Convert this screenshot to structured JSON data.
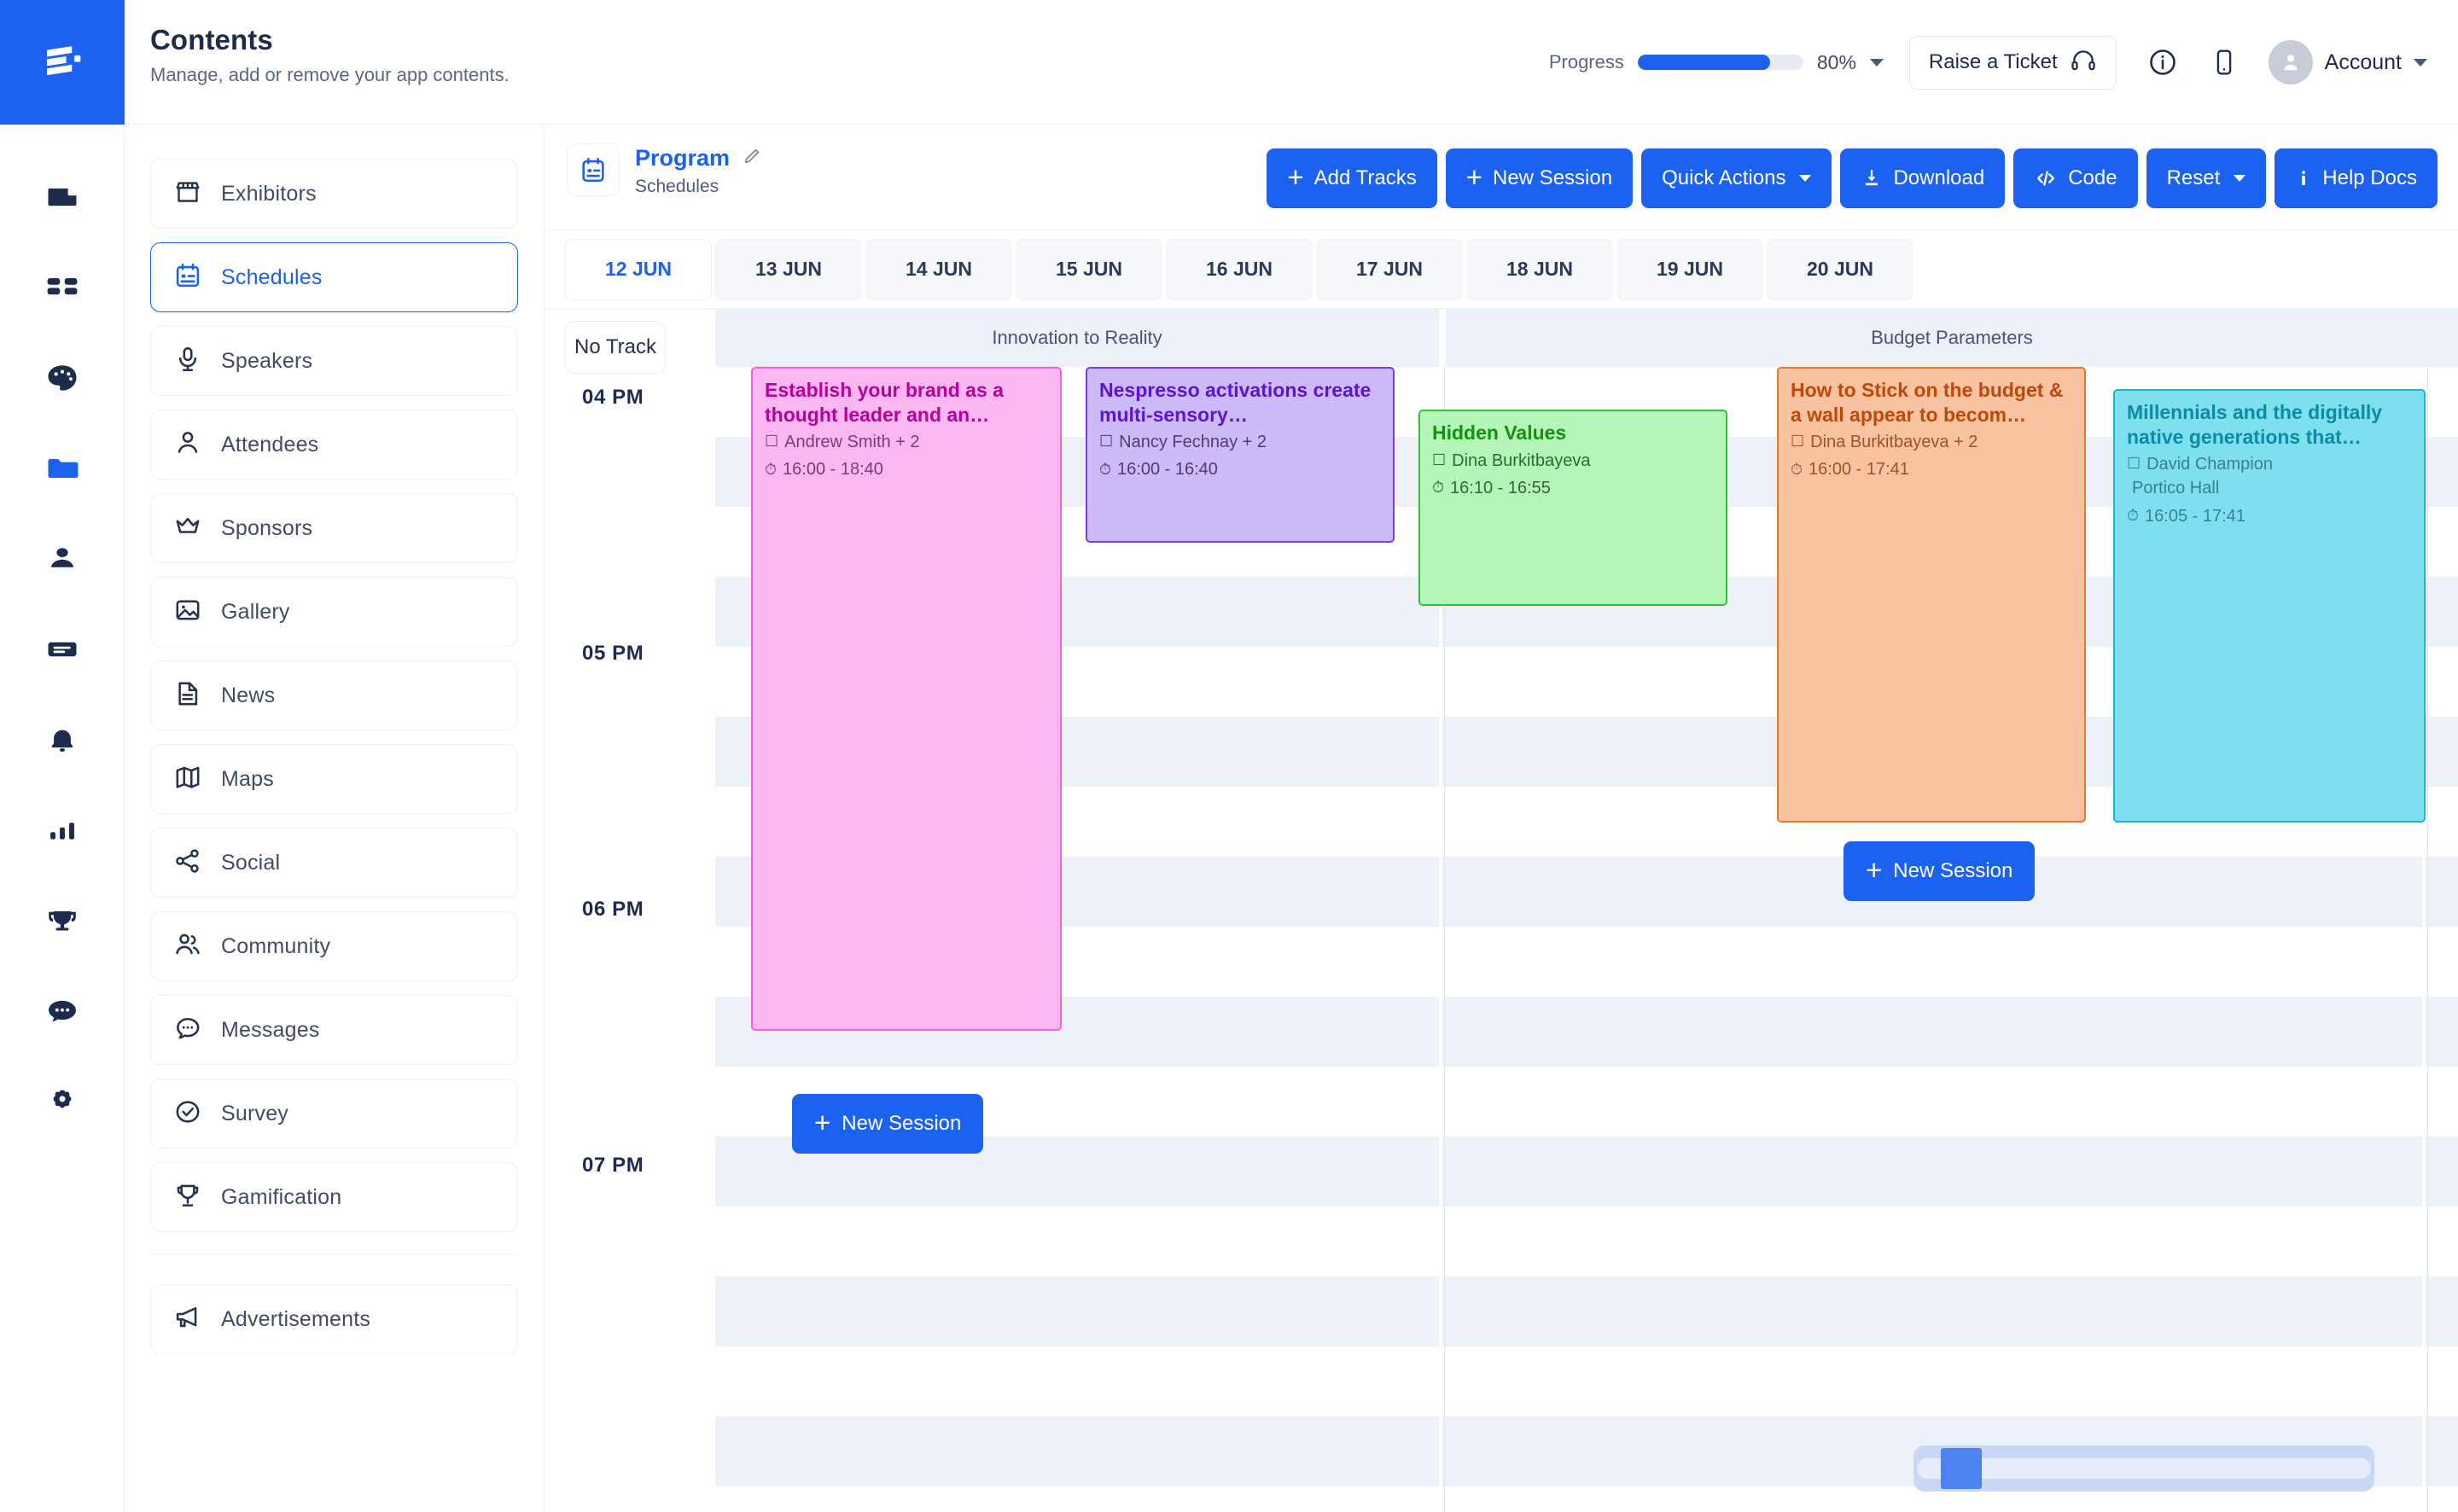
{
  "brand": {
    "logo_icon": "stacked-layers-logo",
    "accent": "#1b61f2"
  },
  "header": {
    "title": "Contents",
    "subtitle": "Manage, add or remove your app contents.",
    "progress_label": "Progress",
    "progress_value": "80%",
    "progress_percent": 80,
    "raise_ticket_label": "Raise a Ticket",
    "headset_icon": "headset-icon",
    "info_icon": "info-circle-icon",
    "mobile_icon": "mobile-phone-icon",
    "avatar_icon": "user-avatar-icon",
    "account_label": "Account"
  },
  "icon_rail": {
    "items": [
      {
        "icon": "document-icon",
        "active": false
      },
      {
        "icon": "dashboard-grid-icon",
        "active": false
      },
      {
        "icon": "palette-icon",
        "active": false
      },
      {
        "icon": "folder-icon",
        "active": true
      },
      {
        "icon": "person-icon",
        "active": false
      },
      {
        "icon": "card-list-icon",
        "active": false
      },
      {
        "icon": "bell-icon",
        "active": false
      },
      {
        "icon": "bar-chart-icon",
        "active": false
      },
      {
        "icon": "trophy-icon",
        "active": false
      },
      {
        "icon": "chat-bubble-icon",
        "active": false
      },
      {
        "icon": "gear-icon",
        "active": false
      }
    ]
  },
  "content_menu": {
    "items": [
      {
        "label": "Exhibitors",
        "icon": "storefront-icon",
        "active": false
      },
      {
        "label": "Schedules",
        "icon": "calendar-icon",
        "active": true
      },
      {
        "label": "Speakers",
        "icon": "microphone-icon",
        "active": false
      },
      {
        "label": "Attendees",
        "icon": "person-icon",
        "active": false
      },
      {
        "label": "Sponsors",
        "icon": "crown-icon",
        "active": false
      },
      {
        "label": "Gallery",
        "icon": "image-icon",
        "active": false
      },
      {
        "label": "News",
        "icon": "news-doc-icon",
        "active": false
      },
      {
        "label": "Maps",
        "icon": "map-icon",
        "active": false
      },
      {
        "label": "Social",
        "icon": "share-icon",
        "active": false
      },
      {
        "label": "Community",
        "icon": "people-icon",
        "active": false
      },
      {
        "label": "Messages",
        "icon": "chat-bubble-icon",
        "active": false
      },
      {
        "label": "Survey",
        "icon": "check-circle-icon",
        "active": false
      },
      {
        "label": "Gamification",
        "icon": "trophy-icon",
        "active": false
      }
    ],
    "footer_items": [
      {
        "label": "Advertisements",
        "icon": "megaphone-icon",
        "active": false
      }
    ]
  },
  "toolbar": {
    "program_icon": "calendar-program-icon",
    "program_name": "Program",
    "edit_icon": "pencil-edit-icon",
    "program_sub": "Schedules",
    "buttons": [
      {
        "label": "Add Tracks",
        "icon": "plus-icon",
        "caret": false
      },
      {
        "label": "New Session",
        "icon": "plus-icon",
        "caret": false
      },
      {
        "label": "Quick Actions",
        "icon": "",
        "caret": true
      },
      {
        "label": "Download",
        "icon": "download-icon",
        "caret": false
      },
      {
        "label": "Code",
        "icon": "code-icon",
        "caret": false
      },
      {
        "label": "Reset",
        "icon": "",
        "caret": true
      },
      {
        "label": "Help Docs",
        "icon": "info-i-icon",
        "caret": false
      }
    ]
  },
  "date_tabs": {
    "items": [
      {
        "label": "12 JUN",
        "active": true
      },
      {
        "label": "13 JUN",
        "active": false
      },
      {
        "label": "14 JUN",
        "active": false
      },
      {
        "label": "15 JUN",
        "active": false
      },
      {
        "label": "16 JUN",
        "active": false
      },
      {
        "label": "17 JUN",
        "active": false
      },
      {
        "label": "18 JUN",
        "active": false
      },
      {
        "label": "19 JUN",
        "active": false
      },
      {
        "label": "20 JUN",
        "active": false
      }
    ]
  },
  "calendar": {
    "no_track_label": "No Track",
    "tracks": [
      {
        "label": "Innovation to Reality"
      },
      {
        "label": "Budget Parameters"
      }
    ],
    "hours": [
      "04 PM",
      "05 PM",
      "06 PM",
      "07 PM"
    ],
    "person_icon": "speaker-square-icon",
    "clock_icon": "clock-icon",
    "sessions": [
      {
        "title": "Establish your brand as a thought leader and an…",
        "speaker": "Andrew Smith + 2",
        "room": "",
        "time": "16:00 - 18:40",
        "fill": "#fbb8f0",
        "border": "#ef64de",
        "text": "#b8009f"
      },
      {
        "title": "Nespresso activations create multi-sensory…",
        "speaker": "Nancy Fechnay + 2",
        "room": "",
        "time": "16:00 - 16:40",
        "fill": "#cdbaf9",
        "border": "#7c3aed",
        "text": "#5b14d6"
      },
      {
        "title": "Hidden Values",
        "speaker": "Dina Burkitbayeva",
        "room": "",
        "time": "16:10 - 16:55",
        "fill": "#b6f5b8",
        "border": "#34bf3a",
        "text": "#12930f"
      },
      {
        "title": "How to Stick on the budget & a wall appear to becom…",
        "speaker": "Dina Burkitbayeva + 2",
        "room": "",
        "time": "16:00 - 17:41",
        "fill": "#f9c3a1",
        "border": "#e8792c",
        "text": "#bf4a08"
      },
      {
        "title": "Millennials and the digitally native generations that…",
        "speaker": "David Champion",
        "room": "Portico Hall",
        "time": "16:05 - 17:41",
        "fill": "#7ee0ef",
        "border": "#16b8d4",
        "text": "#0e8ba3"
      }
    ],
    "new_session_label": "New Session",
    "scrollbar": {
      "name": "horizontal-scrollbar",
      "thumb_position_percent": 6
    }
  }
}
